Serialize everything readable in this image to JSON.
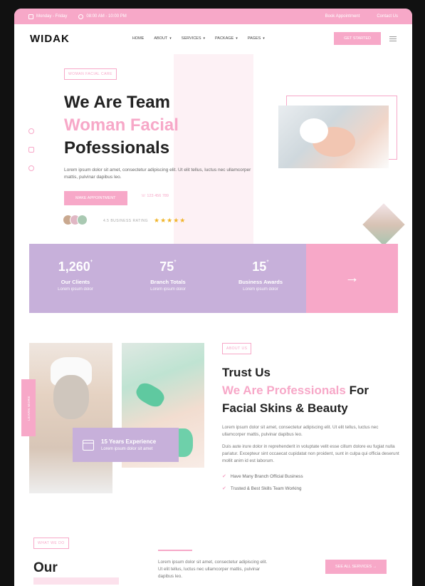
{
  "topbar": {
    "days": "Monday - Friday",
    "hours": "08:00 AM - 10:00 PM",
    "book": "Book Appointment",
    "contact": "Contact Us"
  },
  "nav": {
    "logo": "WIDAK",
    "items": [
      "HOME",
      "ABOUT",
      "SERVICES",
      "PACKAGE",
      "PAGES"
    ],
    "cta": "GET STARTED"
  },
  "hero": {
    "badge": "WOMAN FACIAL CARE",
    "line1": "We Are Team",
    "line2": "Woman Facial",
    "line3": "Pofessionals",
    "description": "Lorem ipsum dolor sit amet, consectetur adipiscing elit. Ut elit tellus, luctus nec ullamcorper mattis, pulvinar dapibus leo.",
    "button": "MAKE APPOINTMENT",
    "phone": "☏ 123 456 789",
    "rating_label": "4.5 BUSINESS RATING",
    "stars": "★★★★★"
  },
  "stats": [
    {
      "num": "1,260",
      "sup": "+",
      "label": "Our Clients",
      "sub": "Lorem ipsum dolor"
    },
    {
      "num": "75",
      "sup": "+",
      "label": "Branch Totals",
      "sub": "Lorem ipsum dolor"
    },
    {
      "num": "15",
      "sup": "+",
      "label": "Business Awards",
      "sub": "Lorem ipsum dolor"
    }
  ],
  "stats_arrow": "→",
  "about": {
    "badge": "ABOUT US",
    "learn_more": "LEARN MORE",
    "experience_title": "15 Years Experience",
    "experience_sub": "Lorem ipsum dolor sit amet",
    "title1": "Trust Us",
    "title2_pink": "We Are Professionals",
    "title2_rest": " For",
    "title3": "Facial Skins & Beauty",
    "para1": "Lorem ipsum dolor sit amet, consectetur adipiscing elit. Ut elit tellus, luctus nec ullamcorper mattis, pulvinar dapibus leo.",
    "para2": "Duis aute irure dolor in reprehenderit in voluptate velit esse cillum dolore eu fugiat nulla pariatur. Excepteur sint occaecat cupidatat non proident, sunt in culpa qui officia deserunt mollit anim id est laborum.",
    "checks": [
      "Have Many Branch Official Business",
      "Trusted & Best Skills Team Working"
    ]
  },
  "services": {
    "badge": "WHAT WE DO",
    "title": "Our",
    "description": "Lorem ipsum dolor sit amet, consectetur adipiscing elit. Ut elit tellus, luctus nec ullamcorper mattis, pulvinar dapibus leo.",
    "see_all": "SEE ALL SERVICES →"
  },
  "colors": {
    "pink": "#f7a8c8",
    "lavender": "#c7b0da"
  }
}
